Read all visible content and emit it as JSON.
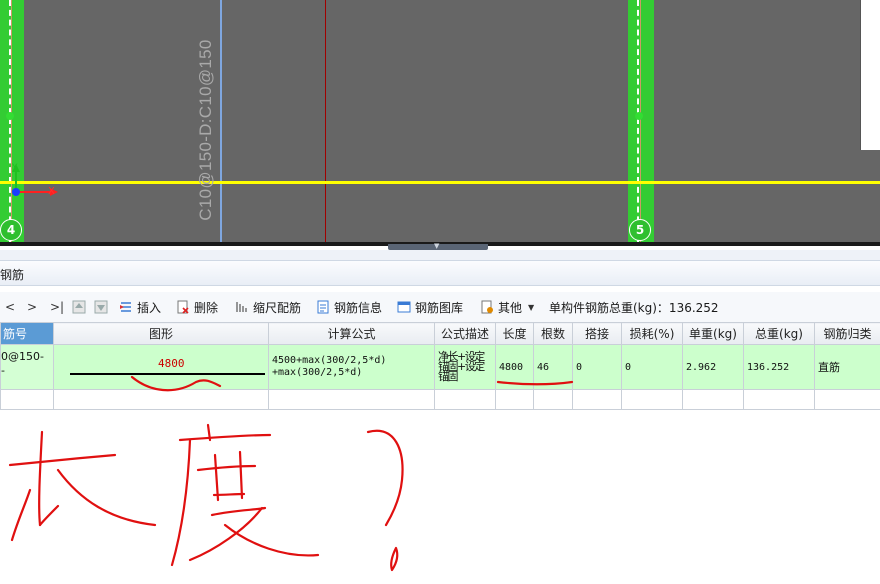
{
  "canvas": {
    "rebar_label": "C10@150-D:C10@150",
    "axis_labels": [
      "4",
      "5"
    ],
    "axis_x": "X",
    "axis_y": "Y",
    "colors": {
      "background": "#666666",
      "column": "#33cc33",
      "yellow_line": "#ffff00",
      "blue_line": "#7fa7e0",
      "red_line": "#a00000"
    }
  },
  "panel": {
    "title": "钢筋"
  },
  "toolbar": {
    "nav_prev": "<",
    "nav_next": ">",
    "nav_last": ">|",
    "insert": "插入",
    "delete": "删除",
    "scale_rebar": "缩尺配筋",
    "rebar_info": "钢筋信息",
    "rebar_library": "钢筋图库",
    "other": "其他",
    "total_weight_label": "单构件钢筋总重(kg)：136.252"
  },
  "table": {
    "headers": [
      "筋号",
      "图形",
      "计算公式",
      "公式描述",
      "长度",
      "根数",
      "搭接",
      "损耗(%)",
      "单重(kg)",
      "总重(kg)",
      "钢筋归类"
    ],
    "row": {
      "bar_no": "0@150-",
      "bar_no_2": "-",
      "shape_value": "4800",
      "formula_1": "4500+max(300/2,5*d)",
      "formula_2": "+max(300/2,5*d)",
      "desc_1": "净长+设定",
      "desc_2": "锚固+设定",
      "desc_3": "锚固",
      "length": "4800",
      "count": "46",
      "lap": "0",
      "loss": "0",
      "unit_weight": "2.962",
      "total_weight": "136.252",
      "category": "直筋"
    }
  }
}
